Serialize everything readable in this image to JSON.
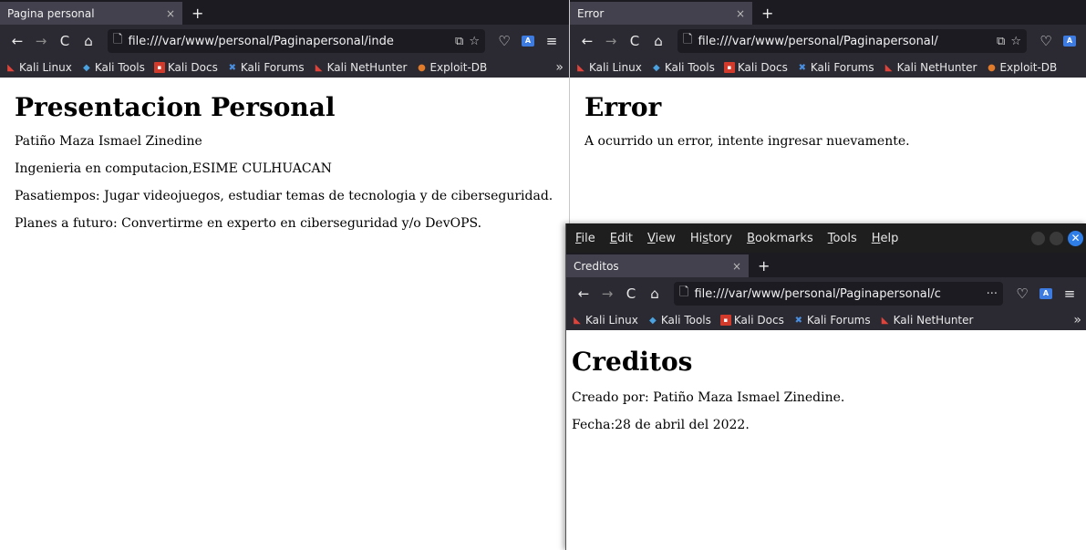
{
  "windows": {
    "personal": {
      "tab": {
        "title": "Pagina personal",
        "close": "×",
        "new_tab": "+"
      },
      "nav": {
        "back": "←",
        "forward": "→",
        "reload": "C",
        "home": "⌂",
        "url": "file:///var/www/personal/Paginapersonal/inde",
        "page_icon": "🗋",
        "reader": "⧉",
        "star": "☆",
        "pocket": "♡",
        "ext": "A",
        "menu": "≡"
      },
      "bookmarks": [
        "Kali Linux",
        "Kali Tools",
        "Kali Docs",
        "Kali Forums",
        "Kali NetHunter",
        "Exploit-DB"
      ],
      "bookmarks_more": "»",
      "page": {
        "heading": "Presentacion Personal",
        "lines": [
          "Patiño Maza Ismael Zinedine",
          "Ingenieria en computacion,ESIME CULHUACAN",
          "Pasatiempos: Jugar videojuegos, estudiar temas de tecnologia y de ciberseguridad.",
          "Planes a futuro: Convertirme en experto en ciberseguridad y/o DevOPS."
        ]
      }
    },
    "error": {
      "tab": {
        "title": "Error",
        "close": "×",
        "new_tab": "+"
      },
      "nav": {
        "back": "←",
        "forward": "→",
        "reload": "C",
        "home": "⌂",
        "url": "file:///var/www/personal/Paginapersonal/",
        "page_icon": "🗋",
        "reader": "⧉",
        "star": "☆",
        "pocket": "♡",
        "ext": "A"
      },
      "bookmarks": [
        "Kali Linux",
        "Kali Tools",
        "Kali Docs",
        "Kali Forums",
        "Kali NetHunter",
        "Exploit-DB"
      ],
      "page": {
        "heading": "Error",
        "message": "A ocurrido un error, intente ingresar nuevamente."
      }
    },
    "creditos": {
      "menu": [
        "File",
        "Edit",
        "View",
        "History",
        "Bookmarks",
        "Tools",
        "Help"
      ],
      "tab": {
        "title": "Creditos",
        "close": "×",
        "new_tab": "+"
      },
      "nav": {
        "back": "←",
        "forward": "→",
        "reload": "C",
        "home": "⌂",
        "url": "file:///var/www/personal/Paginapersonal/c",
        "page_icon": "🗋",
        "more": "···",
        "pocket": "♡",
        "ext": "A",
        "menu": "≡"
      },
      "bookmarks": [
        "Kali Linux",
        "Kali Tools",
        "Kali Docs",
        "Kali Forums",
        "Kali NetHunter"
      ],
      "bookmarks_more": "»",
      "close_symbol": "✕",
      "page": {
        "heading": "Creditos",
        "lines": [
          "Creado por: Patiño Maza Ismael Zinedine.",
          "Fecha:28 de abril del 2022."
        ]
      }
    }
  }
}
